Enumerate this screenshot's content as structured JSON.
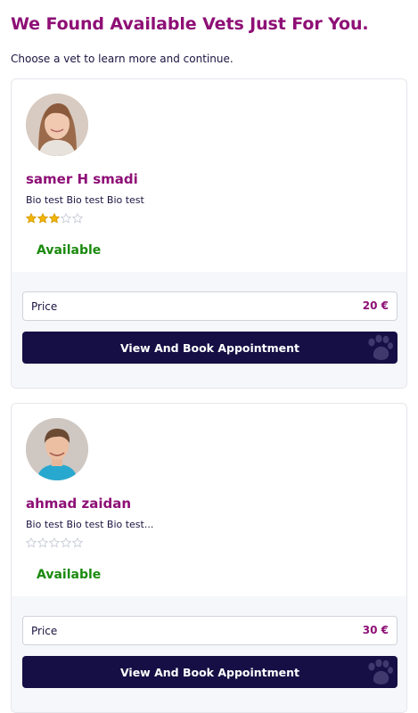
{
  "header": {
    "title": "We Found Available Vets Just For You.",
    "subtitle": "Choose a vet to learn more and continue."
  },
  "vets": [
    {
      "name": "samer H smadi",
      "bio": "Bio test Bio test Bio test",
      "rating": 3,
      "rating_max": 5,
      "status": "Available",
      "price_label": "Price",
      "price_value": "20 €",
      "button_label": "View And Book Appointment",
      "avatar_icon": "woman-portrait-avatar"
    },
    {
      "name": "ahmad zaidan",
      "bio": "Bio test Bio test Bio test...",
      "rating": 0,
      "rating_max": 5,
      "status": "Available",
      "price_label": "Price",
      "price_value": "30 €",
      "button_label": "View And Book Appointment",
      "avatar_icon": "man-portrait-avatar"
    }
  ],
  "colors": {
    "brand_magenta": "#8e0f76",
    "navy": "#150f45",
    "available_green": "#1a8a0e",
    "star_filled": "#f2b705",
    "star_empty": "#c9cdd8"
  },
  "icons": {
    "star": "star-icon",
    "paw": "paw-icon"
  }
}
